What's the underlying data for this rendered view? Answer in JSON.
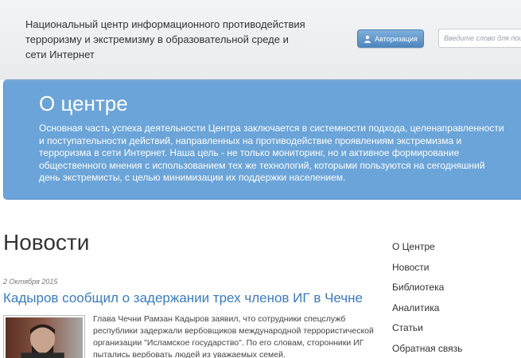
{
  "header": {
    "site_title": "Национальный центр информационного противодействия терроризму и экстремизму в образовательной среде и сети Интернет",
    "auth_button_label": "Авторизация",
    "search_placeholder": "Введите слово для поиск"
  },
  "hero": {
    "title": "О центре",
    "text": " Основная часть успеха деятельности Центра заключается в системности подхода, целенаправленности и поступательности действий, направленных на противодействие проявлениям экстремизма и терроризма в сети Интернет. Наша цель - не только мониторинг, но и активное формирование общественного мнения с использованием тех же технологий, которыми пользуются на сегодняшний день экстремисты, с целью минимизации их поддержки населением."
  },
  "news": {
    "heading": "Новости",
    "items": [
      {
        "date": "2 Октября 2015",
        "title": "Кадыров сообщил о задержании трех членов ИГ в Чечне",
        "excerpt": "Глава Чечни Рамзан Кадыров заявил, что сотрудники спецслужб республики задержали вербовщиков международной террористической организации \"Исламское государство\". По его словам, сторонники ИГ пытались вербовать людей из уважаемых семей."
      }
    ]
  },
  "sidebar": {
    "items": [
      {
        "label": "О Центре"
      },
      {
        "label": "Новости"
      },
      {
        "label": "Библиотека"
      },
      {
        "label": "Аналитика"
      },
      {
        "label": "Статьи"
      },
      {
        "label": "Обратная связь"
      }
    ]
  },
  "icons": {
    "auth_button_icon": "user-icon"
  },
  "colors": {
    "hero_background": "#6ba4d8",
    "link": "#3a7bbf",
    "button": "#5a92c8"
  }
}
